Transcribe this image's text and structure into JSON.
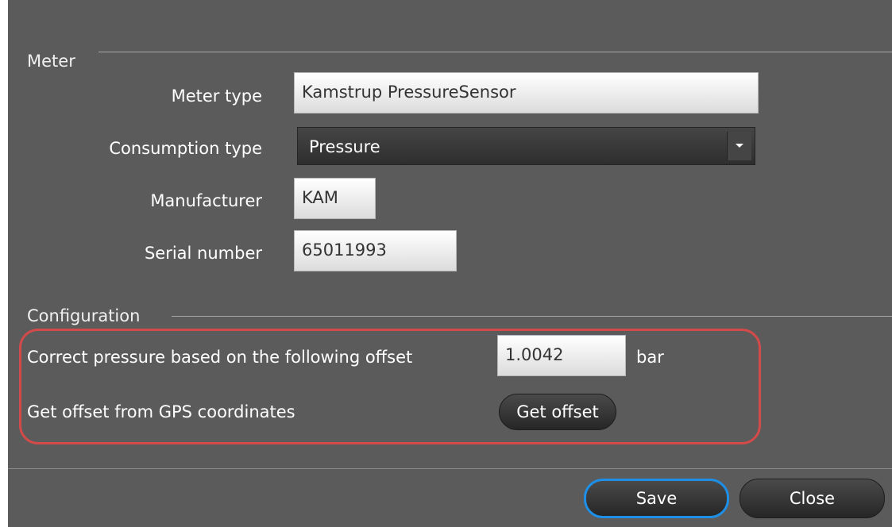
{
  "meter": {
    "section_title": "Meter",
    "meter_type_label": "Meter type",
    "meter_type_value": "Kamstrup PressureSensor",
    "consumption_type_label": "Consumption type",
    "consumption_type_value": "Pressure",
    "manufacturer_label": "Manufacturer",
    "manufacturer_value": "KAM",
    "serial_number_label": "Serial number",
    "serial_number_value": "65011993"
  },
  "configuration": {
    "section_title": "Configuration",
    "offset_label": "Correct pressure based on the following offset",
    "offset_value": "1.0042",
    "offset_unit": "bar",
    "gps_label": "Get offset from GPS coordinates",
    "get_offset_button": "Get offset"
  },
  "footer": {
    "save_button": "Save",
    "close_button": "Close"
  },
  "colors": {
    "panel_background": "#5b5b5b",
    "highlight_border": "#d24a4a",
    "focus_ring": "#1e8fe6"
  },
  "icons": {
    "combo_dropdown": "chevron-down-icon"
  }
}
